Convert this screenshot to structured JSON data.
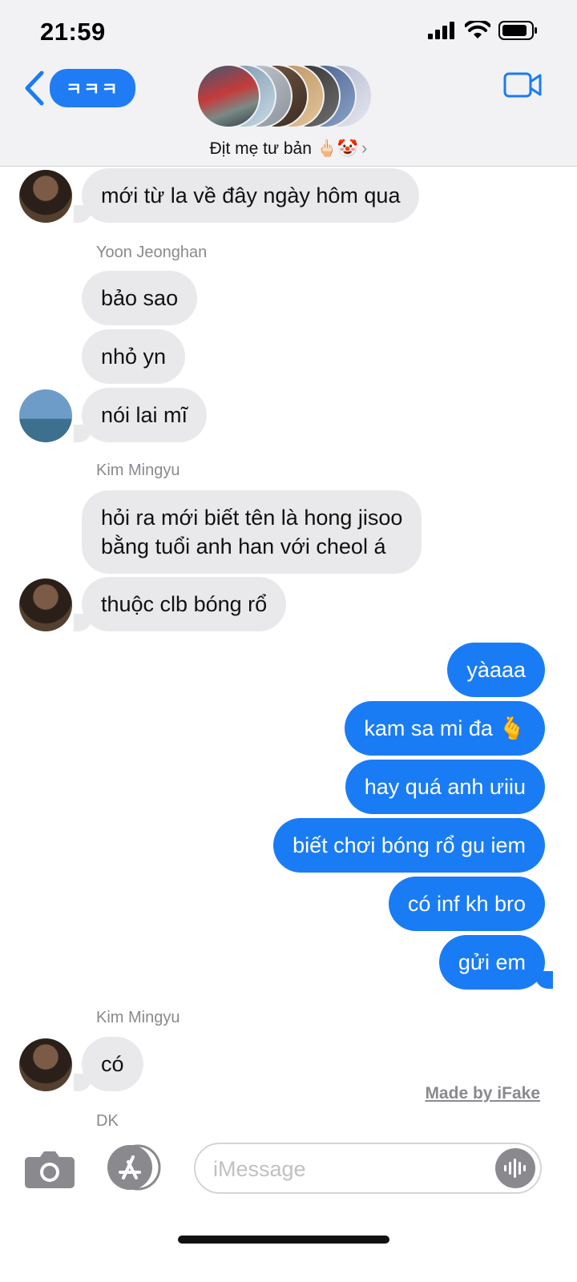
{
  "status_bar": {
    "time": "21:59"
  },
  "header": {
    "back_label": "ㅋㅋㅋ",
    "group_name": "Địt mẹ tư bản 🖕🏻🤡",
    "chevron": "›",
    "video_icon": "video-camera-icon"
  },
  "messages": [
    {
      "dir": "in",
      "text": "mới từ la về đây ngày hôm qua"
    },
    {
      "sender": "Yoon Jeonghan"
    },
    {
      "dir": "in",
      "text": "bảo sao"
    },
    {
      "dir": "in",
      "text": "nhỏ yn"
    },
    {
      "dir": "in",
      "text": "nói lai mĩ"
    },
    {
      "sender": "Kim Mingyu"
    },
    {
      "dir": "in",
      "text": "hỏi ra mới biết tên là hong jisoo\nbằng tuổi anh han với cheol á"
    },
    {
      "dir": "in",
      "text": "thuộc clb bóng rổ"
    },
    {
      "dir": "out",
      "text": "yàaaa"
    },
    {
      "dir": "out",
      "text": "kam sa mi đa 🫰"
    },
    {
      "dir": "out",
      "text": "hay quá anh ưiiu"
    },
    {
      "dir": "out",
      "text": "biết chơi bóng rổ gu iem"
    },
    {
      "dir": "out",
      "text": "có inf kh bro"
    },
    {
      "dir": "out",
      "text": "gửi em"
    },
    {
      "sender": "Kim Mingyu"
    },
    {
      "dir": "in",
      "text": "có"
    },
    {
      "sender": "DK"
    }
  ],
  "watermark": "Made by iFake",
  "composer": {
    "placeholder": "iMessage"
  },
  "colors": {
    "accent": "#1a7cf5",
    "incoming_bubble": "#e9e9eb"
  }
}
